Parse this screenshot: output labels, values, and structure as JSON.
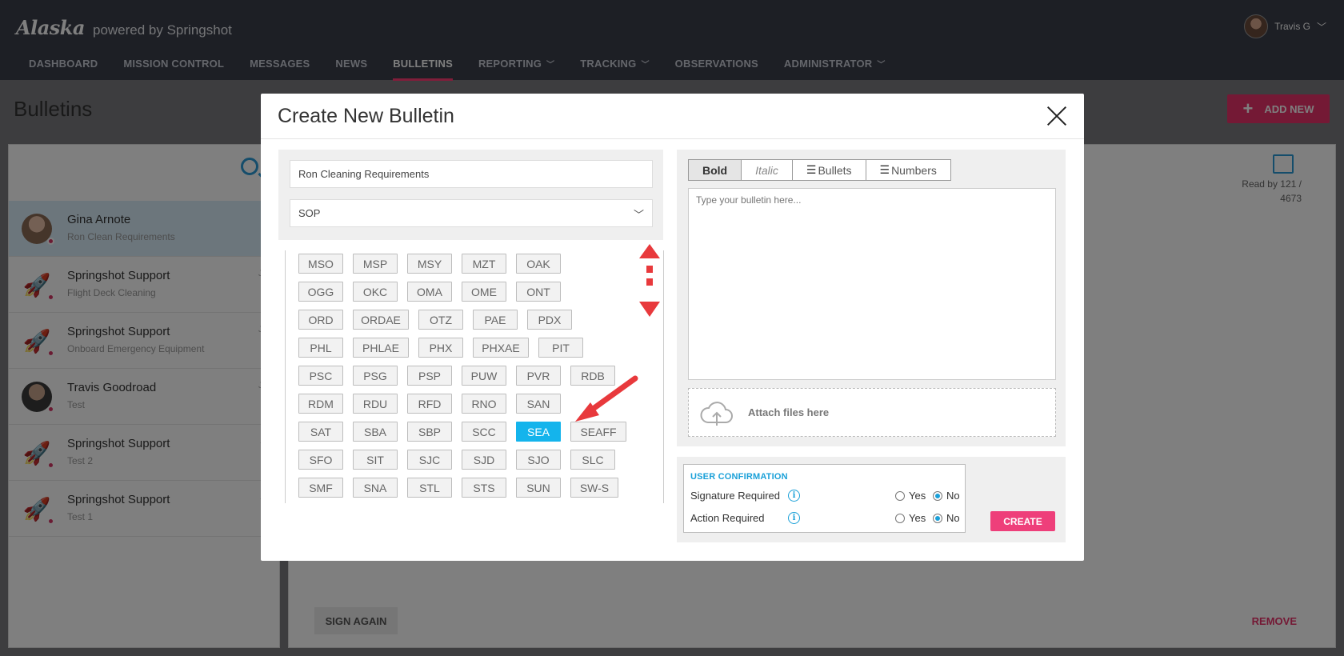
{
  "app": {
    "brand": "Alaska",
    "brand_sub": "powered by Springshot",
    "user_name": "Travis G"
  },
  "nav": [
    {
      "label": "DASHBOARD",
      "caret": false,
      "active": false
    },
    {
      "label": "MISSION CONTROL",
      "caret": false,
      "active": false
    },
    {
      "label": "MESSAGES",
      "caret": false,
      "active": false
    },
    {
      "label": "NEWS",
      "caret": false,
      "active": false
    },
    {
      "label": "BULLETINS",
      "caret": false,
      "active": true
    },
    {
      "label": "REPORTING",
      "caret": true,
      "active": false
    },
    {
      "label": "TRACKING",
      "caret": true,
      "active": false
    },
    {
      "label": "OBSERVATIONS",
      "caret": false,
      "active": false
    },
    {
      "label": "ADMINISTRATOR",
      "caret": true,
      "active": false
    }
  ],
  "page": {
    "title": "Bulletins",
    "add_new_label": "ADD NEW"
  },
  "feed": [
    {
      "name": "Gina Arnote",
      "sub": "Ron Clean Requirements",
      "date": "W",
      "avatar": "person",
      "selected": true
    },
    {
      "name": "Springshot Support",
      "sub": "Flight Deck Cleaning",
      "date": "Jul",
      "avatar": "rocket",
      "selected": false
    },
    {
      "name": "Springshot Support",
      "sub": "Onboard Emergency Equipment",
      "date": "Jul",
      "avatar": "rocket",
      "selected": false
    },
    {
      "name": "Travis Goodroad",
      "sub": "Test",
      "date": "Jul",
      "avatar": "person2",
      "selected": false
    },
    {
      "name": "Springshot Support",
      "sub": "Test 2",
      "date": "Ju",
      "avatar": "rocket",
      "selected": false
    },
    {
      "name": "Springshot Support",
      "sub": "Test 1",
      "date": "Ju",
      "avatar": "rocket",
      "selected": false
    }
  ],
  "detail": {
    "read_by": "Read by 121 / 4673",
    "sign_again_label": "SIGN AGAIN",
    "remove_label": "REMOVE"
  },
  "modal": {
    "title": "Create New Bulletin",
    "title_value": "Ron Cleaning Requirements",
    "category_value": "SOP",
    "format": {
      "bold": "Bold",
      "italic": "Italic",
      "bullets": "Bullets",
      "numbers": "Numbers"
    },
    "body_placeholder": "Type your bulletin here...",
    "attach_label": "Attach files here",
    "confirm": {
      "title": "USER CONFIRMATION",
      "rows": [
        {
          "label": "Signature Required",
          "yes": "Yes",
          "no": "No",
          "selected": "No"
        },
        {
          "label": "Action Required",
          "yes": "Yes",
          "no": "No",
          "selected": "No"
        }
      ]
    },
    "create_label": "CREATE",
    "selected_station": "SEA",
    "stations": [
      [
        "MSO",
        "MSP",
        "MSY",
        "MZT",
        "OAK"
      ],
      [
        "OGG",
        "OKC",
        "OMA",
        "OME",
        "ONT"
      ],
      [
        "ORD",
        "ORDAE",
        "OTZ",
        "PAE",
        "PDX"
      ],
      [
        "PHL",
        "PHLAE",
        "PHX",
        "PHXAE",
        "PIT"
      ],
      [
        "PSC",
        "PSG",
        "PSP",
        "PUW",
        "PVR",
        "RDB"
      ],
      [
        "RDM",
        "RDU",
        "RFD",
        "RNO",
        "SAN"
      ],
      [
        "SAT",
        "SBA",
        "SBP",
        "SCC",
        "SEA",
        "SEAFF"
      ],
      [
        "SFO",
        "SIT",
        "SJC",
        "SJD",
        "SJO",
        "SLC"
      ],
      [
        "SMF",
        "SNA",
        "STL",
        "STS",
        "SUN",
        "SW-S"
      ]
    ]
  },
  "colors": {
    "accent_pink": "#ee3f7a",
    "accent_blue": "#14b4ec",
    "header_bg": "#3b3e4b",
    "annotation_red": "#e8393c"
  }
}
